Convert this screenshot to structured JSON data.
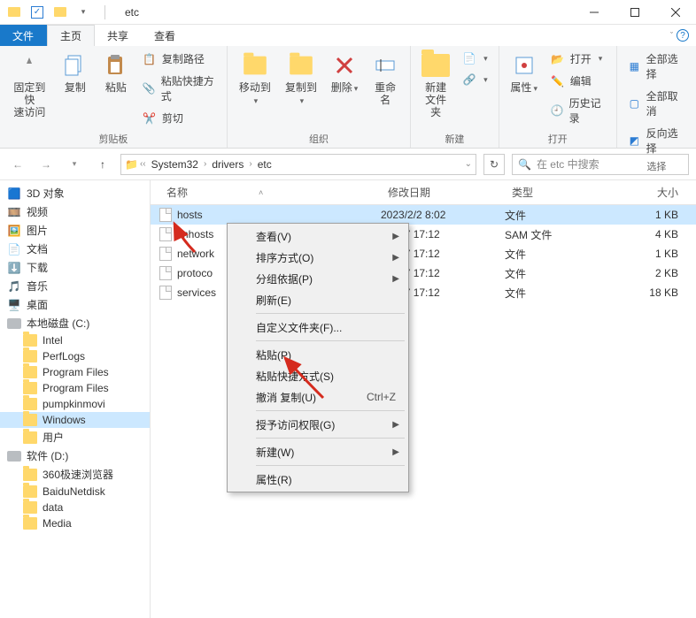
{
  "window": {
    "title": "etc"
  },
  "tabs": {
    "file": "文件",
    "home": "主页",
    "share": "共享",
    "view": "查看"
  },
  "ribbon": {
    "pin": "固定到快\n速访问",
    "copy": "复制",
    "paste": "粘贴",
    "copy_path": "复制路径",
    "paste_shortcut": "粘贴快捷方式",
    "cut": "剪切",
    "group_clipboard": "剪贴板",
    "move_to": "移动到",
    "copy_to": "复制到",
    "delete": "删除",
    "rename": "重命名",
    "group_organize": "组织",
    "new_folder": "新建\n文件夹",
    "group_new": "新建",
    "properties": "属性",
    "open": "打开",
    "edit": "编辑",
    "history": "历史记录",
    "group_open": "打开",
    "select_all": "全部选择",
    "select_none": "全部取消",
    "invert": "反向选择",
    "group_select": "选择"
  },
  "breadcrumb": {
    "items": [
      "System32",
      "drivers",
      "etc"
    ]
  },
  "search": {
    "placeholder": "在 etc 中搜索"
  },
  "tree": {
    "items": [
      {
        "label": "3D 对象",
        "icon": "obj",
        "indent": 0
      },
      {
        "label": "视频",
        "icon": "vid",
        "indent": 0
      },
      {
        "label": "图片",
        "icon": "pic",
        "indent": 0
      },
      {
        "label": "文档",
        "icon": "doc",
        "indent": 0
      },
      {
        "label": "下载",
        "icon": "dl",
        "indent": 0
      },
      {
        "label": "音乐",
        "icon": "mus",
        "indent": 0
      },
      {
        "label": "桌面",
        "icon": "desk",
        "indent": 0
      },
      {
        "label": "本地磁盘 (C:)",
        "icon": "disk",
        "indent": 0
      },
      {
        "label": "Intel",
        "icon": "folder",
        "indent": 1
      },
      {
        "label": "PerfLogs",
        "icon": "folder",
        "indent": 1
      },
      {
        "label": "Program Files",
        "icon": "folder",
        "indent": 1
      },
      {
        "label": "Program Files",
        "icon": "folder",
        "indent": 1
      },
      {
        "label": "pumpkinmovi",
        "icon": "folder",
        "indent": 1
      },
      {
        "label": "Windows",
        "icon": "folder",
        "indent": 1,
        "selected": true
      },
      {
        "label": "用户",
        "icon": "folder",
        "indent": 1
      },
      {
        "label": "软件 (D:)",
        "icon": "disk",
        "indent": 0
      },
      {
        "label": "360极速浏览器",
        "icon": "folder",
        "indent": 1
      },
      {
        "label": "BaiduNetdisk",
        "icon": "folder",
        "indent": 1
      },
      {
        "label": "data",
        "icon": "folder",
        "indent": 1
      },
      {
        "label": "Media",
        "icon": "folder",
        "indent": 1
      }
    ]
  },
  "columns": {
    "name": "名称",
    "date": "修改日期",
    "type": "类型",
    "size": "大小"
  },
  "files": [
    {
      "name": "hosts",
      "date": "2023/2/2 8:02",
      "type": "文件",
      "size": "1 KB",
      "selected": true
    },
    {
      "name": "lmhosts",
      "date": "9/12/7 17:12",
      "type": "SAM 文件",
      "size": "4 KB"
    },
    {
      "name": "network",
      "date": "9/12/7 17:12",
      "type": "文件",
      "size": "1 KB"
    },
    {
      "name": "protoco",
      "date": "9/12/7 17:12",
      "type": "文件",
      "size": "2 KB"
    },
    {
      "name": "services",
      "date": "9/12/7 17:12",
      "type": "文件",
      "size": "18 KB"
    }
  ],
  "context_menu": {
    "view": "查看(V)",
    "sort": "排序方式(O)",
    "group": "分组依据(P)",
    "refresh": "刷新(E)",
    "customize": "自定义文件夹(F)...",
    "paste": "粘贴(P)",
    "paste_shortcut": "粘贴快捷方式(S)",
    "undo": "撤消 复制(U)",
    "undo_key": "Ctrl+Z",
    "grant": "授予访问权限(G)",
    "new": "新建(W)",
    "properties": "属性(R)"
  }
}
